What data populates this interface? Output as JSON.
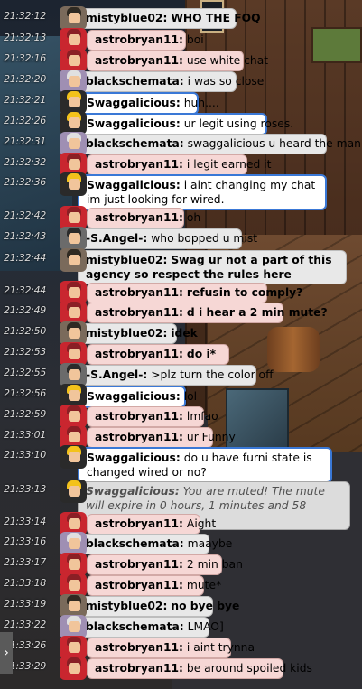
{
  "chat": [
    {
      "time": "21:32:12",
      "user": "mistyblue02:",
      "msg": "WHO THE FOQ",
      "style": "grey",
      "bold_msg": true,
      "avatar": "av-misty"
    },
    {
      "time": "21:32:13",
      "user": "astrobryan11:",
      "msg": "boi",
      "style": "pink",
      "avatar": "av-pink"
    },
    {
      "time": "21:32:16",
      "user": "astrobryan11:",
      "msg": "use white chat",
      "style": "pink",
      "avatar": "av-pink"
    },
    {
      "time": "21:32:20",
      "user": "blackschemata:",
      "msg": "i was so close",
      "style": "grey",
      "avatar": "av-grey"
    },
    {
      "time": "21:32:21",
      "user": "Swaggalicious:",
      "msg": "huh....",
      "style": "blue",
      "avatar": "av-gold"
    },
    {
      "time": "21:32:26",
      "user": "Swaggalicious:",
      "msg": "ur legit using roses.",
      "style": "blue",
      "avatar": "av-gold"
    },
    {
      "time": "21:32:31",
      "user": "blackschemata:",
      "msg": "swaggalicious u heard the man",
      "style": "grey",
      "avatar": "av-grey"
    },
    {
      "time": "21:32:32",
      "user": "astrobryan11:",
      "msg": "i legit earned it",
      "style": "pink",
      "avatar": "av-pink"
    },
    {
      "time": "21:32:36",
      "user": "Swaggalicious:",
      "msg": "i aint changing my chat im just looking for wired.",
      "style": "blue",
      "multi": true,
      "avatar": "av-gold"
    },
    {
      "time": "21:32:42",
      "user": "astrobryan11:",
      "msg": "oh",
      "style": "pink",
      "avatar": "av-pink"
    },
    {
      "time": "21:32:43",
      "user": "-S.Angel-:",
      "msg": "who bopped u mist",
      "style": "grey",
      "avatar": "av-dark"
    },
    {
      "time": "21:32:44",
      "user": "mistyblue02:",
      "msg": "Swag ur not a part of this agency so respect the rules here",
      "style": "grey",
      "bold_msg": true,
      "multi": true,
      "avatar": "av-misty"
    },
    {
      "time": "21:32:44",
      "user": "astrobryan11:",
      "msg": "refusin to comply?",
      "style": "pink",
      "bold_msg": true,
      "avatar": "av-pink"
    },
    {
      "time": "21:32:49",
      "user": "astrobryan11:",
      "msg": "d i hear a 2 min mute?",
      "style": "pink",
      "bold_msg": true,
      "avatar": "av-pink"
    },
    {
      "time": "21:32:50",
      "user": "mistyblue02:",
      "msg": "idek",
      "style": "grey",
      "bold_msg": true,
      "avatar": "av-misty"
    },
    {
      "time": "21:32:53",
      "user": "astrobryan11:",
      "msg": "do i*",
      "style": "pink",
      "bold_msg": true,
      "avatar": "av-pink"
    },
    {
      "time": "21:32:55",
      "user": "-S.Angel-:",
      "msg": ">plz turn the color off",
      "style": "grey",
      "avatar": "av-dark"
    },
    {
      "time": "21:32:56",
      "user": "Swaggalicious:",
      "msg": "lol",
      "style": "blue",
      "avatar": "av-gold"
    },
    {
      "time": "21:32:59",
      "user": "astrobryan11:",
      "msg": "lmfao",
      "style": "pink",
      "avatar": "av-pink"
    },
    {
      "time": "21:33:01",
      "user": "astrobryan11:",
      "msg": "ur Funny",
      "style": "pink",
      "avatar": "av-pink"
    },
    {
      "time": "21:33:10",
      "user": "Swaggalicious:",
      "msg": "do u have furni state is changed wired or no?",
      "style": "blue",
      "multi": true,
      "avatar": "av-gold"
    },
    {
      "time": "21:33:13",
      "user": "Swaggalicious:",
      "msg": "You are muted! The mute will expire in 0 hours, 1 minutes and 58 seconds.",
      "style": "system",
      "multi": true,
      "avatar": "av-gold"
    },
    {
      "time": "21:33:14",
      "user": "astrobryan11:",
      "msg": "Aight",
      "style": "pink",
      "avatar": "av-pink"
    },
    {
      "time": "21:33:16",
      "user": "blackschemata:",
      "msg": "maaybe",
      "style": "grey",
      "avatar": "av-grey"
    },
    {
      "time": "21:33:17",
      "user": "astrobryan11:",
      "msg": "2 min ban",
      "style": "pink",
      "avatar": "av-pink"
    },
    {
      "time": "21:33:18",
      "user": "astrobryan11:",
      "msg": "mute*",
      "style": "pink",
      "avatar": "av-pink"
    },
    {
      "time": "21:33:19",
      "user": "mistyblue02:",
      "msg": "no bye bye",
      "style": "grey",
      "bold_msg": true,
      "avatar": "av-misty"
    },
    {
      "time": "21:33:22",
      "user": "blackschemata:",
      "msg": "LMAO]",
      "style": "grey",
      "avatar": "av-grey"
    },
    {
      "time": "21:33:26",
      "user": "astrobryan11:",
      "msg": "i aint trynna",
      "style": "pink",
      "avatar": "av-pink"
    },
    {
      "time": "21:33:29",
      "user": "astrobryan11:",
      "msg": "be around spoiled kids",
      "style": "pink",
      "avatar": "av-pink"
    }
  ],
  "expand_glyph": "›"
}
